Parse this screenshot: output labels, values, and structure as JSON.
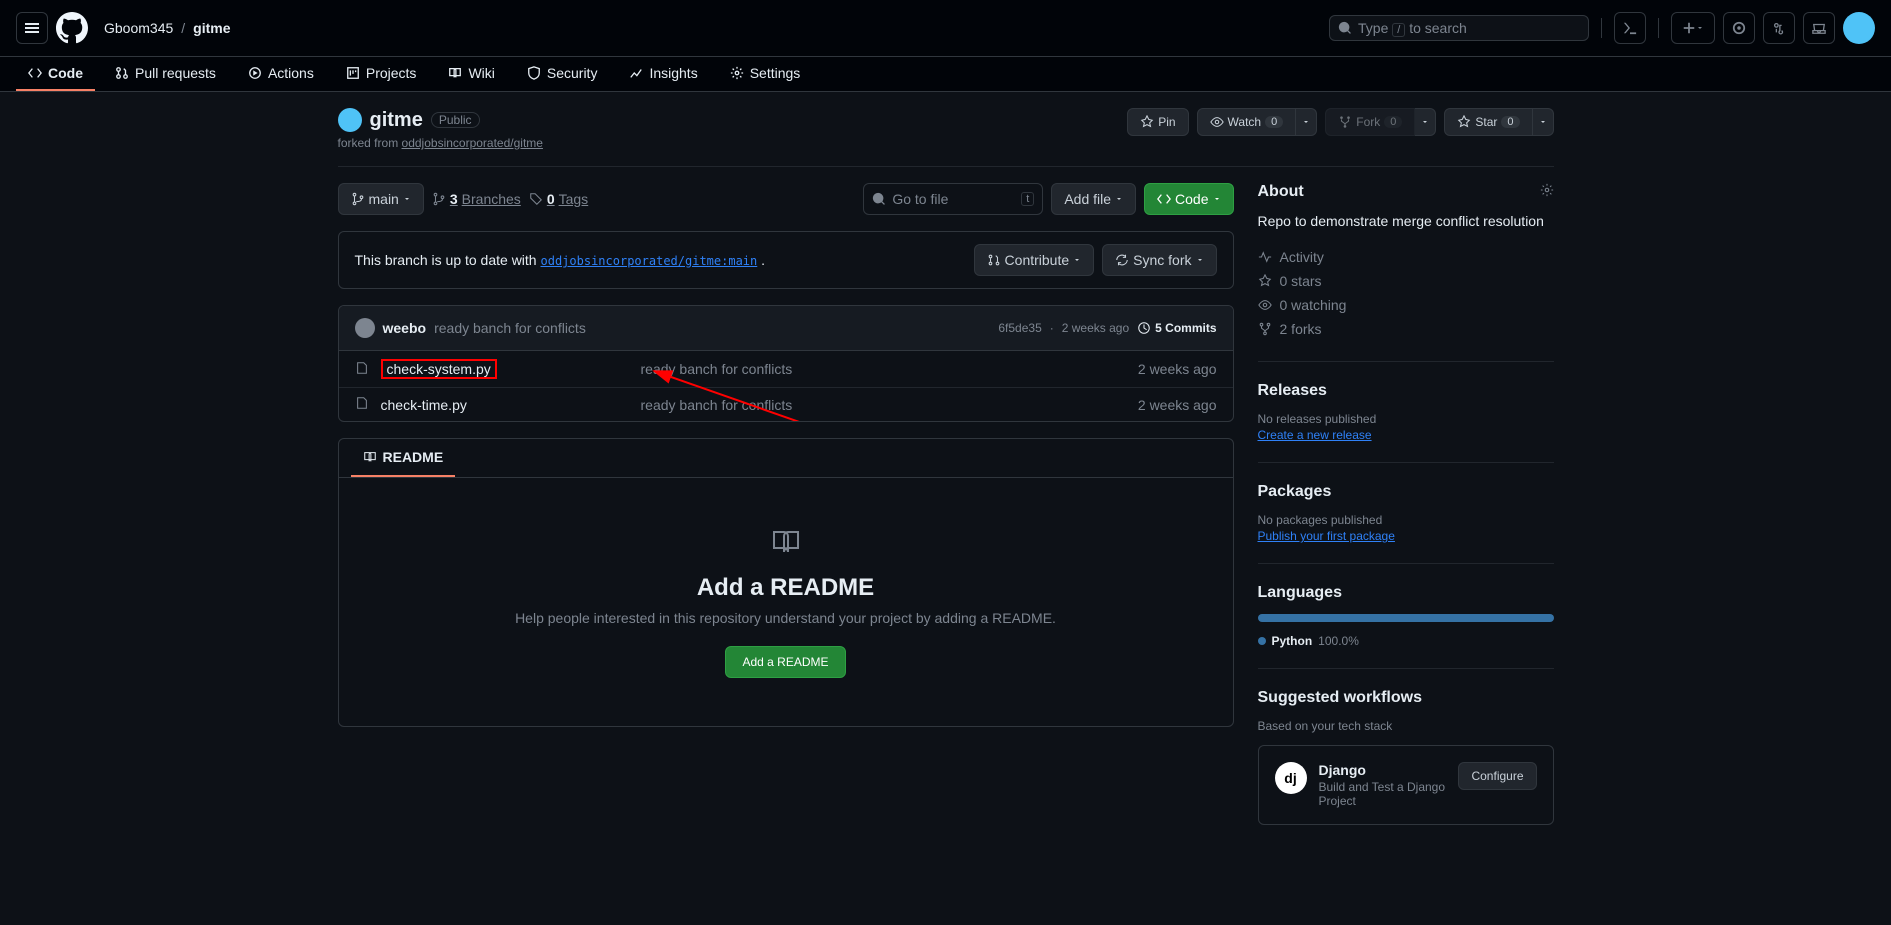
{
  "header": {
    "owner": "Gboom345",
    "repo": "gitme",
    "search_placeholder": "Type / to search"
  },
  "nav": {
    "code": "Code",
    "pulls": "Pull requests",
    "actions": "Actions",
    "projects": "Projects",
    "wiki": "Wiki",
    "security": "Security",
    "insights": "Insights",
    "settings": "Settings"
  },
  "repo": {
    "name": "gitme",
    "visibility": "Public",
    "forked_from_prefix": "forked from ",
    "forked_from_link": "oddjobsincorporated/gitme",
    "pin": "Pin",
    "watch": "Watch",
    "watch_count": "0",
    "fork": "Fork",
    "fork_count": "0",
    "star": "Star",
    "star_count": "0"
  },
  "toolbar": {
    "branch": "main",
    "branches_count": "3",
    "branches_label": "Branches",
    "tags_count": "0",
    "tags_label": "Tags",
    "go_to_file": "Go to file",
    "add_file": "Add file",
    "code": "Code"
  },
  "branch_status": {
    "prefix": "This branch is up to date with",
    "link": "oddjobsincorporated/gitme:main",
    "contribute": "Contribute",
    "sync": "Sync fork"
  },
  "commits": {
    "author": "weebo",
    "message": "ready banch for conflicts",
    "sha": "6f5de35",
    "date": "2 weeks ago",
    "count_text": "5 Commits"
  },
  "files": [
    {
      "name": "check-system.py",
      "msg": "ready banch for conflicts",
      "date": "2 weeks ago",
      "highlight": true
    },
    {
      "name": "check-time.py",
      "msg": "ready banch for conflicts",
      "date": "2 weeks ago",
      "highlight": false
    }
  ],
  "readme": {
    "tab": "README",
    "title": "Add a README",
    "subtitle": "Help people interested in this repository understand your project by adding a README.",
    "button": "Add a README"
  },
  "about": {
    "title": "About",
    "description": "Repo to demonstrate merge conflict resolution",
    "activity": "Activity",
    "stars": "0 stars",
    "watching": "0 watching",
    "forks": "2 forks"
  },
  "releases": {
    "title": "Releases",
    "empty": "No releases published",
    "link": "Create a new release"
  },
  "packages": {
    "title": "Packages",
    "empty": "No packages published",
    "link": "Publish your first package"
  },
  "languages": {
    "title": "Languages",
    "lang": "Python",
    "pct": "100.0%"
  },
  "workflows": {
    "title": "Suggested workflows",
    "subtitle": "Based on your tech stack",
    "django": "Django",
    "django_sub": "Build and Test a Django Project",
    "configure": "Configure"
  }
}
